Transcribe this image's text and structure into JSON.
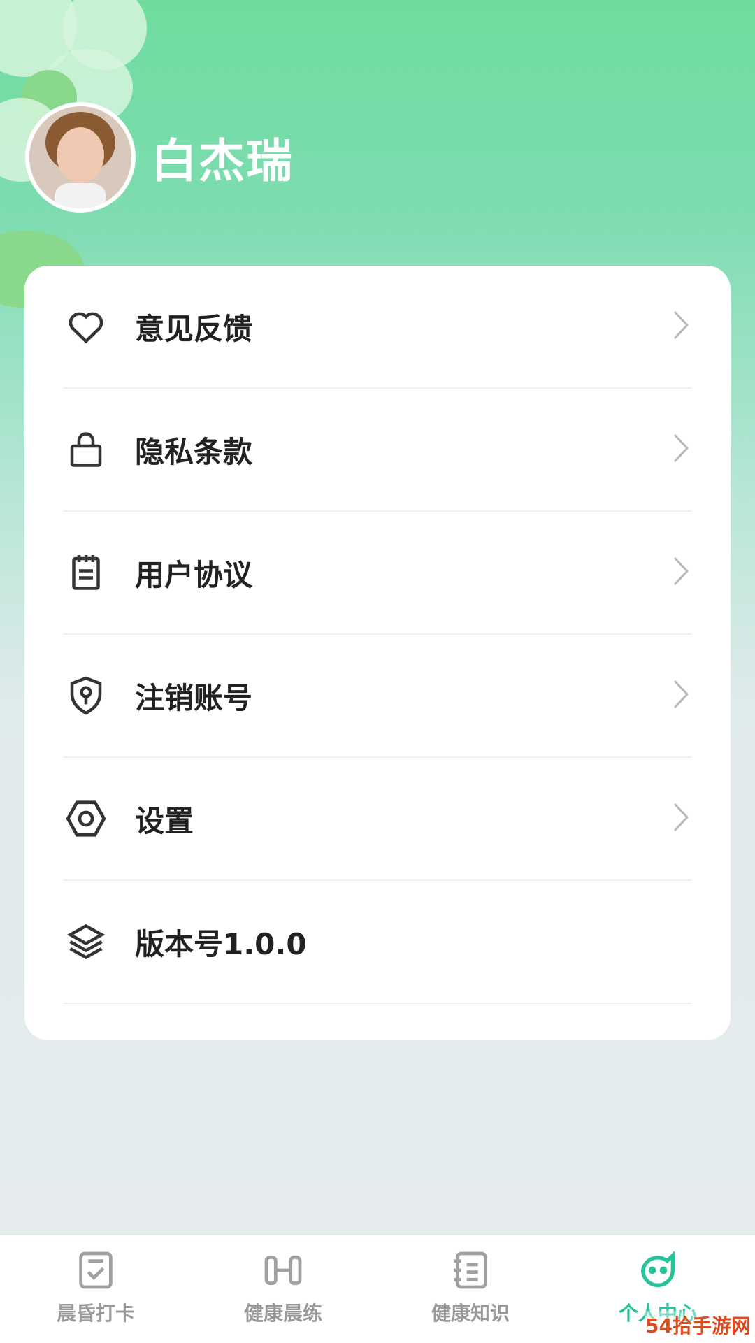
{
  "profile": {
    "username": "白杰瑞"
  },
  "menu": {
    "items": [
      {
        "label": "意见反馈",
        "icon": "heart-icon"
      },
      {
        "label": "隐私条款",
        "icon": "lock-icon"
      },
      {
        "label": "用户协议",
        "icon": "document-icon"
      },
      {
        "label": "注销账号",
        "icon": "shield-key-icon"
      },
      {
        "label": "设置",
        "icon": "hexagon-settings-icon"
      },
      {
        "label": "版本号1.0.0",
        "icon": "layers-icon"
      }
    ]
  },
  "tabbar": {
    "tabs": [
      {
        "label": "晨昏打卡",
        "icon": "checkin-icon"
      },
      {
        "label": "健康晨练",
        "icon": "exercise-icon"
      },
      {
        "label": "健康知识",
        "icon": "notebook-icon"
      },
      {
        "label": "个人中心",
        "icon": "face-icon",
        "active": true
      }
    ]
  },
  "colors": {
    "accent": "#27c39a",
    "header_green": "#6fdc9e"
  },
  "watermark": "54拾手游网"
}
